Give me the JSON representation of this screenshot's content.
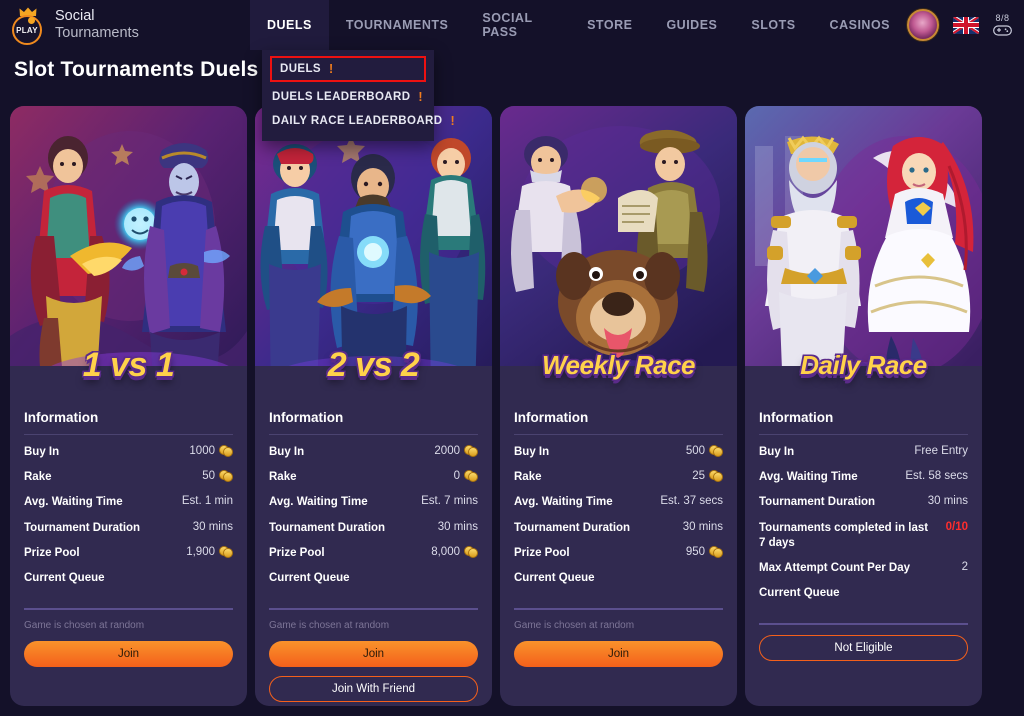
{
  "brand": {
    "line1": "Social",
    "line2": "Tournaments",
    "mark_label": "PLAY"
  },
  "nav": {
    "items": [
      {
        "label": "DUELS",
        "active": true
      },
      {
        "label": "TOURNAMENTS",
        "active": false
      },
      {
        "label": "SOCIAL PASS",
        "active": false
      },
      {
        "label": "STORE",
        "active": false
      },
      {
        "label": "GUIDES",
        "active": false
      },
      {
        "label": "SLOTS",
        "active": false
      },
      {
        "label": "CASINOS",
        "active": false
      }
    ],
    "gamepad_count": "8/8",
    "language_flag": "uk-flag-icon"
  },
  "page_title": "Slot Tournaments Duels",
  "dropdown": {
    "items": [
      {
        "label": "DUELS",
        "badge": "!",
        "highlighted": true
      },
      {
        "label": "DUELS LEADERBOARD",
        "badge": "!",
        "highlighted": false
      },
      {
        "label": "DAILY RACE LEADERBOARD",
        "badge": "!",
        "highlighted": false
      }
    ]
  },
  "info_heading": "Information",
  "labels": {
    "buy_in": "Buy In",
    "rake": "Rake",
    "avg_waiting_time": "Avg. Waiting Time",
    "tournament_duration": "Tournament Duration",
    "prize_pool": "Prize Pool",
    "current_queue": "Current Queue",
    "tournaments_completed": "Tournaments completed in last 7 days",
    "max_attempt": "Max Attempt Count Per Day",
    "random_note": "Game is chosen at random"
  },
  "cards": [
    {
      "title": "1 vs 1",
      "title_size": "lg",
      "buy_in": "1000",
      "buy_in_coin": true,
      "rake": "50",
      "rake_coin": true,
      "avg_waiting_time": "Est. 1 min",
      "tournament_duration": "30 mins",
      "prize_pool": "1,900",
      "prize_pool_coin": true,
      "current_queue": "",
      "note": "Game is chosen at random",
      "primary_button": "Join",
      "secondary_button": null
    },
    {
      "title": "2 vs 2",
      "title_size": "lg",
      "buy_in": "2000",
      "buy_in_coin": true,
      "rake": "0",
      "rake_coin": true,
      "avg_waiting_time": "Est. 7 mins",
      "tournament_duration": "30 mins",
      "prize_pool": "8,000",
      "prize_pool_coin": true,
      "current_queue": "",
      "note": "Game is chosen at random",
      "primary_button": "Join",
      "secondary_button": "Join With Friend"
    },
    {
      "title": "Weekly Race",
      "title_size": "sm",
      "buy_in": "500",
      "buy_in_coin": true,
      "rake": "25",
      "rake_coin": true,
      "avg_waiting_time": "Est. 37 secs",
      "tournament_duration": "30 mins",
      "prize_pool": "950",
      "prize_pool_coin": true,
      "current_queue": "",
      "note": "Game is chosen at random",
      "primary_button": "Join",
      "secondary_button": null
    },
    {
      "title": "Daily Race",
      "title_size": "sm",
      "buy_in": "Free Entry",
      "buy_in_coin": false,
      "avg_waiting_time": "Est. 58 secs",
      "tournament_duration": "30 mins",
      "tournaments_completed": "0/10",
      "max_attempt": "2",
      "current_queue": "",
      "primary_button": "Not Eligible"
    }
  ],
  "colors": {
    "page_background": "#141129",
    "card_background": "#312a50",
    "accent_orange": "#f4601b",
    "accent_gold": "#ffd24a",
    "alert_red": "#ff2d2d",
    "highlight_box": "#ee1111"
  }
}
